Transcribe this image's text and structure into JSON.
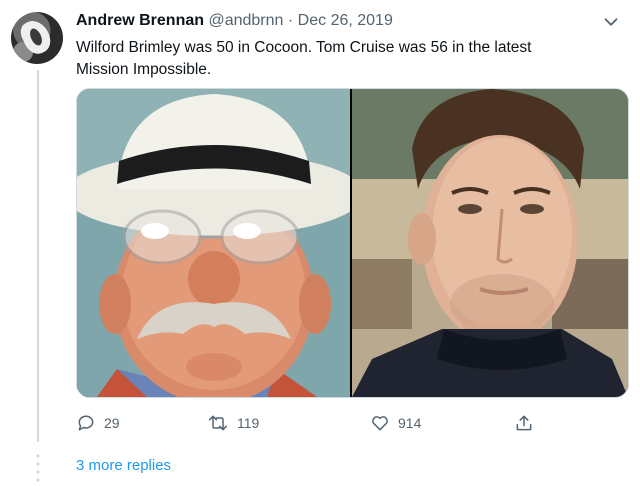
{
  "tweet": {
    "author_name": "Andrew Brennan",
    "author_handle": "@andbrnn",
    "separator": "·",
    "date": "Dec 26, 2019",
    "text": "Wilford Brimley was 50 in Cocoon.  Tom Cruise was 56 in the latest\nMission Impossible.",
    "media": [
      {
        "icon": "photo-older-man-white-hat"
      },
      {
        "icon": "photo-man-dark-turtleneck"
      }
    ],
    "actions": {
      "reply": {
        "icon": "reply-icon",
        "count": "29"
      },
      "retweet": {
        "icon": "retweet-icon",
        "count": "119"
      },
      "like": {
        "icon": "heart-icon",
        "count": "914"
      },
      "share": {
        "icon": "share-icon"
      }
    },
    "more_replies_label": "3 more replies",
    "menu_icon": "chevron-down-icon"
  },
  "colors": {
    "text": "#0f1419",
    "secondary": "#536471",
    "link": "#1d9bf0",
    "divider": "#cfd9de"
  }
}
